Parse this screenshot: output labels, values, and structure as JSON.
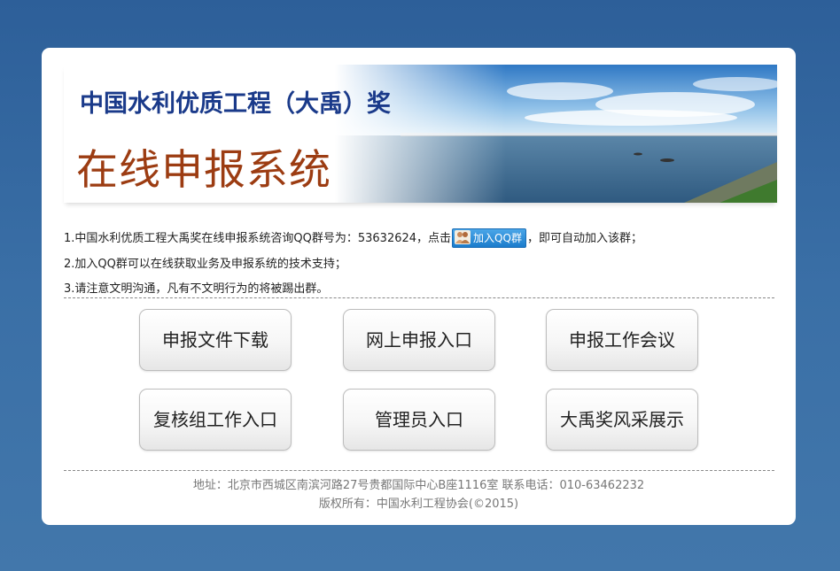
{
  "banner": {
    "title": "中国水利优质工程（大禹）奖",
    "subtitle": "在线申报系统"
  },
  "notes": {
    "line1_prefix": "1.中国水利优质工程大禹奖在线申报系统咨询QQ群号为：53632624，点击",
    "qq_button_label": "加入QQ群",
    "line1_suffix": "，即可自动加入该群；",
    "line2": "2.加入QQ群可以在线获取业务及申报系统的技术支持；",
    "line3": "3.请注意文明沟通，凡有不文明行为的将被踢出群。"
  },
  "buttons": [
    {
      "label": "申报文件下载"
    },
    {
      "label": "网上申报入口"
    },
    {
      "label": "申报工作会议"
    },
    {
      "label": "复核组工作入口"
    },
    {
      "label": "管理员入口"
    },
    {
      "label": "大禹奖风采展示"
    }
  ],
  "footer": {
    "address": "地址：北京市西城区南滨河路27号贵都国际中心B座1116室 联系电话：010-63462232",
    "copyright": "版权所有：中国水利工程协会(©2015)"
  },
  "colors": {
    "page_bg": "#3a6fa6",
    "title_blue": "#1a3a8a",
    "subtitle_brown": "#9c3c12",
    "qq_button": "#1b7ccc"
  },
  "icons": {
    "qq_group": "qq-group-icon"
  }
}
